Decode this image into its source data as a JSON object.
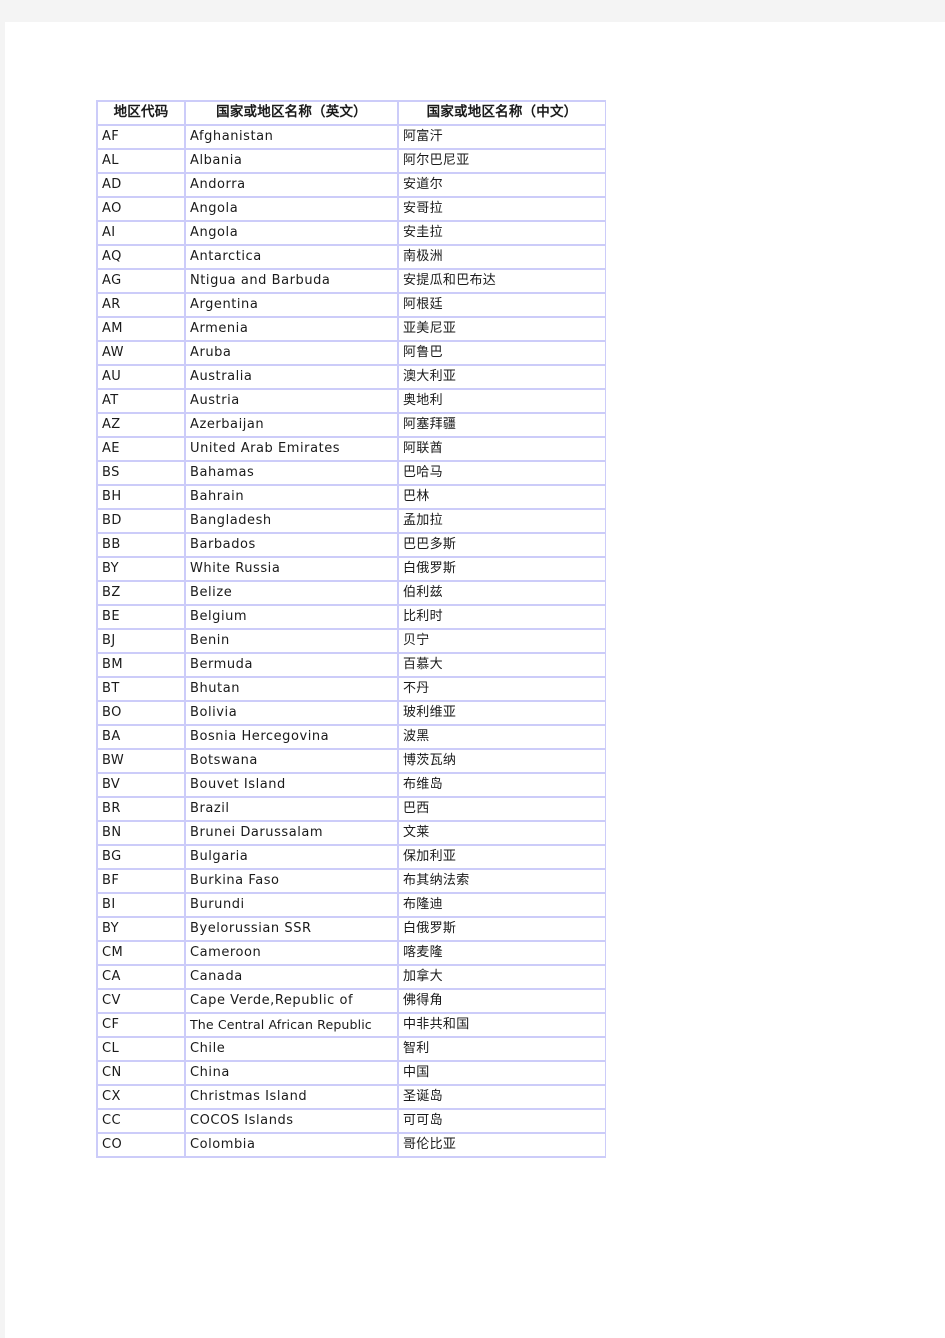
{
  "document": {
    "table": {
      "columns": [
        {
          "key": "code",
          "label": "地区代码"
        },
        {
          "key": "name_en",
          "label": "国家或地区名称（英文）"
        },
        {
          "key": "name_zh",
          "label": "国家或地区名称（中文）"
        }
      ],
      "rows": [
        {
          "code": "AF",
          "name_en": "Afghanistan",
          "name_zh": "阿富汗",
          "tall": false
        },
        {
          "code": "AL",
          "name_en": "Albania",
          "name_zh": "阿尔巴尼亚",
          "tall": false
        },
        {
          "code": "AD",
          "name_en": "Andorra",
          "name_zh": "安道尔",
          "tall": false
        },
        {
          "code": "AO",
          "name_en": "Angola",
          "name_zh": "安哥拉",
          "tall": false
        },
        {
          "code": "AI",
          "name_en": "Angola",
          "name_zh": "安圭拉",
          "tall": false
        },
        {
          "code": "AQ",
          "name_en": "Antarctica",
          "name_zh": "南极洲",
          "tall": false
        },
        {
          "code": "AG",
          "name_en": "Ntigua and Barbuda",
          "name_zh": "安提瓜和巴布达",
          "tall": false
        },
        {
          "code": "AR",
          "name_en": "Argentina",
          "name_zh": "阿根廷",
          "tall": false
        },
        {
          "code": "AM",
          "name_en": "Armenia",
          "name_zh": "亚美尼亚",
          "tall": false
        },
        {
          "code": "AW",
          "name_en": "Aruba",
          "name_zh": "阿鲁巴",
          "tall": false
        },
        {
          "code": "AU",
          "name_en": "Australia",
          "name_zh": "澳大利亚",
          "tall": false
        },
        {
          "code": "AT",
          "name_en": "Austria",
          "name_zh": "奥地利",
          "tall": false
        },
        {
          "code": "AZ",
          "name_en": "Azerbaijan",
          "name_zh": "阿塞拜疆",
          "tall": false
        },
        {
          "code": "AE",
          "name_en": "United Arab Emirates",
          "name_zh": "阿联酋",
          "tall": false
        },
        {
          "code": "BS",
          "name_en": "Bahamas",
          "name_zh": "巴哈马",
          "tall": false
        },
        {
          "code": "BH",
          "name_en": "Bahrain",
          "name_zh": "巴林",
          "tall": false
        },
        {
          "code": "BD",
          "name_en": "Bangladesh",
          "name_zh": "孟加拉",
          "tall": false
        },
        {
          "code": "BB",
          "name_en": "Barbados",
          "name_zh": "巴巴多斯",
          "tall": false
        },
        {
          "code": "BY",
          "name_en": "White Russia",
          "name_zh": "白俄罗斯",
          "tall": false
        },
        {
          "code": "BZ",
          "name_en": "Belize",
          "name_zh": "伯利兹",
          "tall": false
        },
        {
          "code": "BE",
          "name_en": "Belgium",
          "name_zh": "比利时",
          "tall": false
        },
        {
          "code": "BJ",
          "name_en": "Benin",
          "name_zh": "贝宁",
          "tall": false
        },
        {
          "code": "BM",
          "name_en": "Bermuda",
          "name_zh": "百慕大",
          "tall": false
        },
        {
          "code": "BT",
          "name_en": "Bhutan",
          "name_zh": "不丹",
          "tall": false
        },
        {
          "code": "BO",
          "name_en": "Bolivia",
          "name_zh": "玻利维亚",
          "tall": false
        },
        {
          "code": "BA",
          "name_en": "Bosnia Hercegovina",
          "name_zh": "波黑",
          "tall": false
        },
        {
          "code": "BW",
          "name_en": "Botswana",
          "name_zh": "博茨瓦纳",
          "tall": false
        },
        {
          "code": "BV",
          "name_en": "Bouvet Island",
          "name_zh": "布维岛",
          "tall": false
        },
        {
          "code": "BR",
          "name_en": "Brazil",
          "name_zh": "巴西",
          "tall": false
        },
        {
          "code": "BN",
          "name_en": "Brunei Darussalam",
          "name_zh": "文莱",
          "tall": false
        },
        {
          "code": "BG",
          "name_en": "Bulgaria",
          "name_zh": "保加利亚",
          "tall": false
        },
        {
          "code": "BF",
          "name_en": "Burkina Faso",
          "name_zh": "布其纳法索",
          "tall": false
        },
        {
          "code": "BI",
          "name_en": "Burundi",
          "name_zh": "布隆迪",
          "tall": false
        },
        {
          "code": "BY",
          "name_en": "Byelorussian SSR",
          "name_zh": "白俄罗斯",
          "tall": false
        },
        {
          "code": "CM",
          "name_en": "Cameroon",
          "name_zh": "喀麦隆",
          "tall": false
        },
        {
          "code": "CA",
          "name_en": "Canada",
          "name_zh": "加拿大",
          "tall": false
        },
        {
          "code": "CV",
          "name_en": "Cape Verde,Republic of",
          "name_zh": "佛得角",
          "tall": false
        },
        {
          "code": "CF",
          "name_en": "The Central African Republic",
          "name_zh": "中非共和国",
          "tall": true
        },
        {
          "code": "CL",
          "name_en": "Chile",
          "name_zh": "智利",
          "tall": false
        },
        {
          "code": "CN",
          "name_en": "China",
          "name_zh": "中国",
          "tall": false
        },
        {
          "code": "CX",
          "name_en": "Christmas Island",
          "name_zh": "圣诞岛",
          "tall": false
        },
        {
          "code": "CC",
          "name_en": "COCOS Islands",
          "name_zh": "可可岛",
          "tall": false
        },
        {
          "code": "CO",
          "name_en": "Colombia",
          "name_zh": "哥伦比亚",
          "tall": false
        }
      ]
    }
  },
  "theme": {
    "border_color": "#ccccf9",
    "cell_background": "#ffffff",
    "page_background": "#ffffff",
    "canvas_background": "#f4f4f4",
    "text_color": "#1a1a1a"
  }
}
